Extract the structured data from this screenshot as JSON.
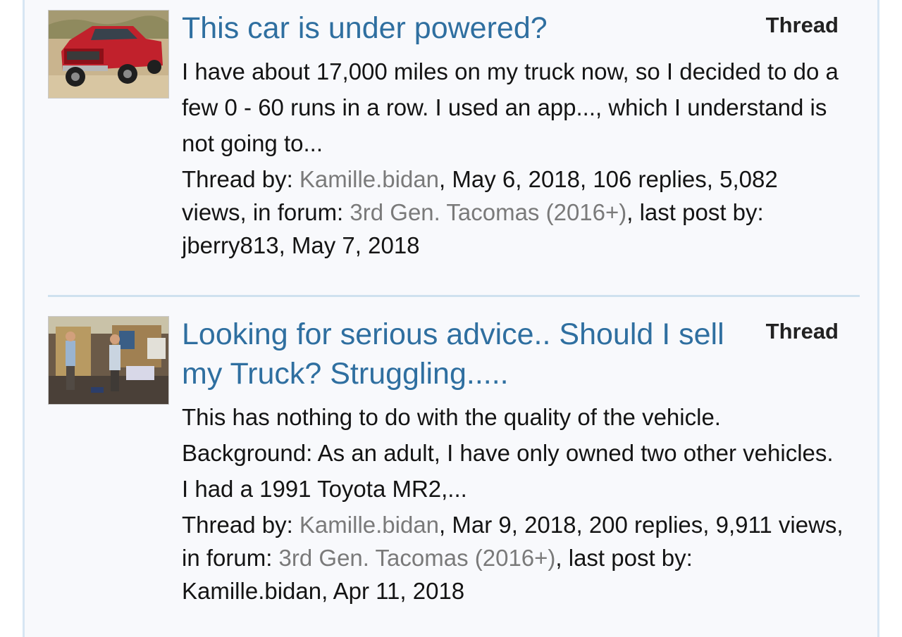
{
  "results": [
    {
      "title": "This car is under powered?",
      "badge": "Thread",
      "snippet": "I have about 17,000 miles on my truck now, so I decided to do a few 0 - 60 runs in a row. I used an app..., which I understand is not going to...",
      "meta": {
        "prefix": "Thread by: ",
        "author": "Kamille.bidan",
        "stats": ", May 6, 2018, 106 replies, 5,082 views, in forum: ",
        "forum": "3rd Gen. Tacomas (2016+)",
        "last": ", last post by: jberry813, May 7, 2018"
      }
    },
    {
      "title": "Looking for serious advice.. Should I sell my Truck? Struggling.....",
      "badge": "Thread",
      "snippet": "This has nothing to do with the quality of the vehicle. Background: As an adult, I have only owned two other vehicles. I had a 1991 Toyota MR2,...",
      "meta": {
        "prefix": "Thread by: ",
        "author": "Kamille.bidan",
        "stats": ", Mar 9, 2018, 200 replies, 9,911 views, in forum: ",
        "forum": "3rd Gen. Tacomas (2016+)",
        "last": ", last post by: Kamille.bidan, Apr 11, 2018"
      }
    }
  ]
}
